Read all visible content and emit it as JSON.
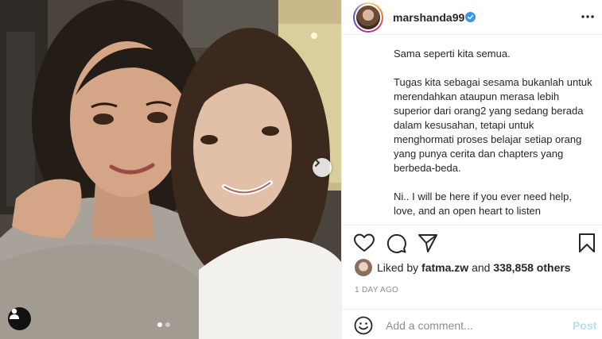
{
  "post": {
    "username": "marshanda99",
    "verified": true,
    "more_icon": "more-horizontal-icon",
    "caption": "Sama seperti kita semua.\n\nTugas kita sebagai sesama bukanlah untuk merendahkan ataupun merasa lebih superior dari orang2 yang sedang berada dalam kesusahan, tetapi untuk menghormati proses belajar setiap orang yang punya cerita dan chapters yang berbeda-beda.\n\nNi.. I will be here if you ever need help, love, and an open heart to listen"
  },
  "actions": {
    "like_icon": "heart-icon",
    "comment_icon": "comment-icon",
    "share_icon": "paper-plane-icon",
    "save_icon": "bookmark-icon"
  },
  "likes": {
    "prefix": "Liked by",
    "user": "fatma.zw",
    "conjunction": "and",
    "count": "338,858 others"
  },
  "timestamp": "1 DAY AGO",
  "comment": {
    "placeholder": "Add a comment...",
    "post_label": "Post"
  },
  "carousel": {
    "slides": 2,
    "current": 1
  },
  "colors": {
    "verified_blue": "#3897f0",
    "post_disabled": "#b2dffc",
    "muted_text": "#8e8e8e"
  }
}
